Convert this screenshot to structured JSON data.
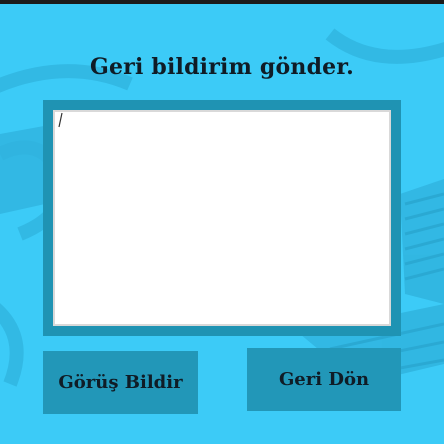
{
  "dialog": {
    "title": "Geri bildirim gönder.",
    "text_value": "",
    "feedback_button_label": "Görüş Bildir",
    "back_button_label": "Geri Dön"
  },
  "colors": {
    "background": "#3ccbf7",
    "frame": "#1f93b3",
    "button": "#2297b8",
    "text": "#0f1c26"
  }
}
